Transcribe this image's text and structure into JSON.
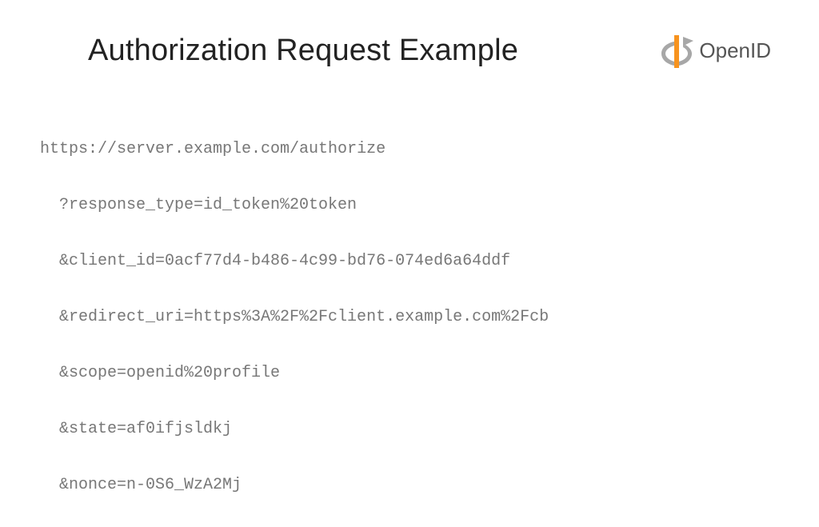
{
  "title": "Authorization Request Example",
  "logo": {
    "text": "OpenID"
  },
  "code": {
    "l0": "https://server.example.com/authorize",
    "l1": "?response_type=id_token%20token",
    "l2": "&client_id=0acf77d4-b486-4c99-bd76-074ed6a64ddf",
    "l3": "&redirect_uri=https%3A%2F%2Fclient.example.com%2Fcb",
    "l4": "&scope=openid%20profile",
    "l5": "&state=af0ifjsldkj",
    "l6": "&nonce=n-0S6_WzA2Mj"
  }
}
